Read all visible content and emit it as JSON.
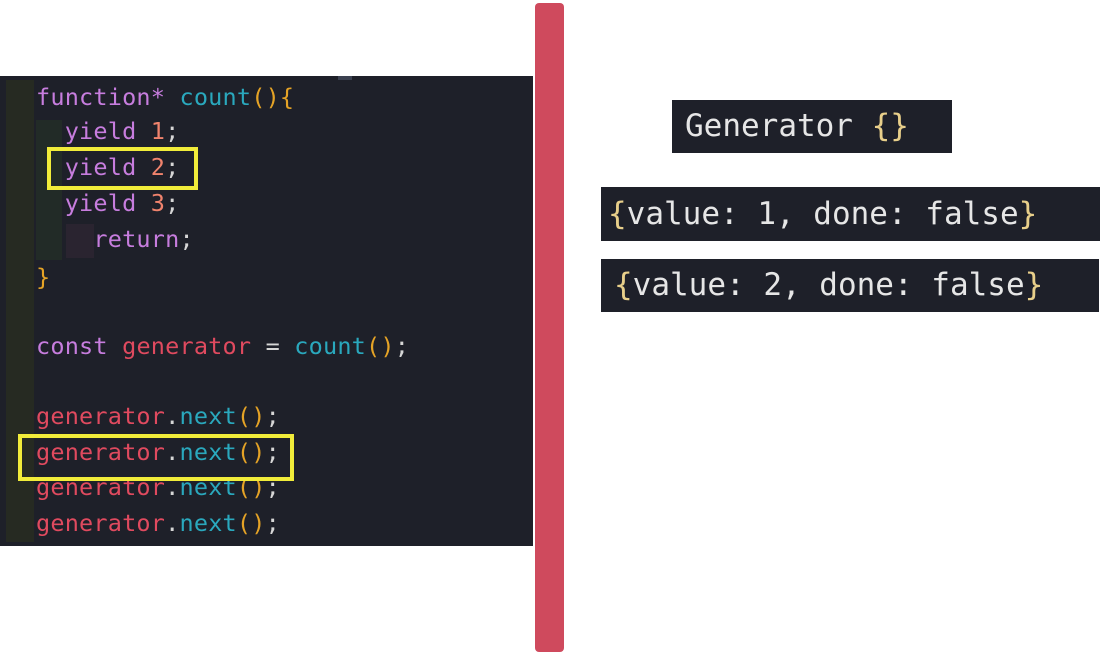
{
  "editor": {
    "lines": [
      {
        "id": "l1",
        "tokens": [
          [
            "kw",
            "function* "
          ],
          [
            "fn",
            "count"
          ],
          [
            "brk",
            "(){"
          ]
        ]
      },
      {
        "id": "l2",
        "tokens": [
          [
            "kw",
            "  yield "
          ],
          [
            "num",
            "1"
          ],
          [
            "pun",
            ";"
          ]
        ]
      },
      {
        "id": "l3",
        "tokens": [
          [
            "kw",
            "  yield "
          ],
          [
            "num",
            "2"
          ],
          [
            "pun",
            ";"
          ]
        ]
      },
      {
        "id": "l4",
        "tokens": [
          [
            "kw",
            "  yield "
          ],
          [
            "num",
            "3"
          ],
          [
            "pun",
            ";"
          ]
        ]
      },
      {
        "id": "l5",
        "tokens": [
          [
            "kw",
            "    return"
          ],
          [
            "pun",
            ";"
          ]
        ]
      },
      {
        "id": "l6",
        "tokens": [
          [
            "brk",
            "}"
          ]
        ]
      },
      {
        "id": "l7",
        "tokens": []
      },
      {
        "id": "l8",
        "tokens": [
          [
            "kw",
            "const "
          ],
          [
            "var",
            "generator "
          ],
          [
            "op",
            "= "
          ],
          [
            "fn",
            "count"
          ],
          [
            "brk",
            "()"
          ],
          [
            "pun",
            ";"
          ]
        ]
      },
      {
        "id": "l9",
        "tokens": []
      },
      {
        "id": "l10",
        "tokens": [
          [
            "var",
            "generator"
          ],
          [
            "pun",
            "."
          ],
          [
            "fn",
            "next"
          ],
          [
            "brk",
            "()"
          ],
          [
            "pun",
            ";"
          ]
        ]
      },
      {
        "id": "l11",
        "tokens": [
          [
            "var",
            "generator"
          ],
          [
            "pun",
            "."
          ],
          [
            "fn",
            "next"
          ],
          [
            "brk",
            "()"
          ],
          [
            "pun",
            ";"
          ]
        ]
      },
      {
        "id": "l12",
        "tokens": [
          [
            "var",
            "generator"
          ],
          [
            "pun",
            "."
          ],
          [
            "fn",
            "next"
          ],
          [
            "brk",
            "()"
          ],
          [
            "pun",
            ";"
          ]
        ]
      },
      {
        "id": "l13",
        "tokens": [
          [
            "var",
            "generator"
          ],
          [
            "pun",
            "."
          ],
          [
            "fn",
            "next"
          ],
          [
            "brk",
            "()"
          ],
          [
            "pun",
            ";"
          ]
        ]
      }
    ]
  },
  "console": {
    "output1": {
      "prefix": "Generator ",
      "brace": "{}"
    },
    "output2": {
      "open": "{",
      "body": "value: 1, done: false",
      "close": "}"
    },
    "output3": {
      "open": "{",
      "body": "value: 2, done: false",
      "close": "}"
    }
  },
  "colors": {
    "editor_bg": "#1e2029",
    "keyword": "#c77dde",
    "function": "#2aa8bd",
    "number": "#f0836d",
    "variable": "#e04a5f",
    "bracket": "#e5a326",
    "highlight": "#f1ec3a",
    "divider": "#cf4a5d"
  }
}
